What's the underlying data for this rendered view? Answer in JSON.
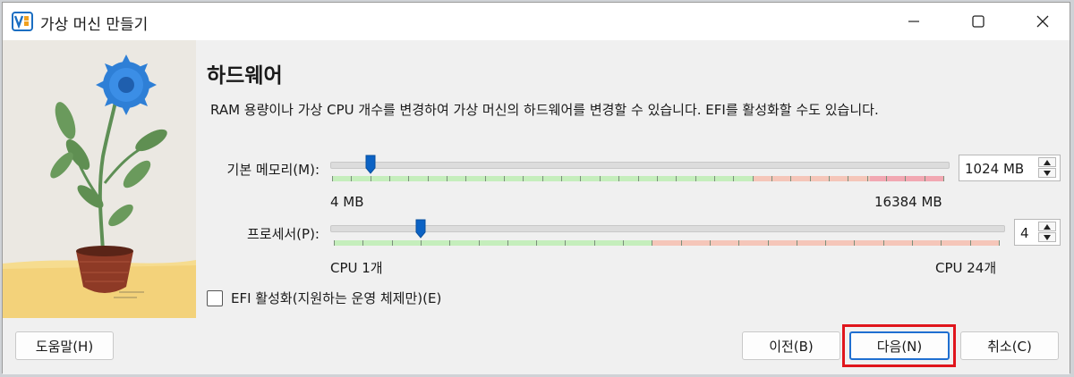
{
  "window": {
    "title": "가상 머신 만들기"
  },
  "page": {
    "heading": "하드웨어",
    "description": "RAM 용량이나 가상 CPU 개수를 변경하여 가상 머신의 하드웨어를 변경할 수 있습니다. EFI를 활성화할 수도 있습니다."
  },
  "memory": {
    "label": "기본 메모리(M):",
    "value": "1024 MB",
    "min_label": "4 MB",
    "max_label": "16384 MB",
    "slider_fraction": 0.0622
  },
  "processor": {
    "label": "프로세서(P):",
    "value": "4",
    "min_label": "CPU 1개",
    "max_label": "CPU 24개",
    "slider_fraction": 0.1304
  },
  "efi": {
    "label": "EFI 활성화(지원하는 운영 체제만)(E)",
    "checked": false
  },
  "buttons": {
    "help": "도움말(H)",
    "back": "이전(B)",
    "next": "다음(N)",
    "cancel": "취소(C)"
  },
  "colors": {
    "range_green": "#c5eebc",
    "range_orange": "#f5c6b9",
    "range_red": "#f2a8b2",
    "thumb": "#0b62c4",
    "highlight": "#e0151c"
  },
  "icons": {
    "app": "virtualbox-icon",
    "minimize": "minimize-icon",
    "maximize": "maximize-icon",
    "close": "close-icon"
  }
}
